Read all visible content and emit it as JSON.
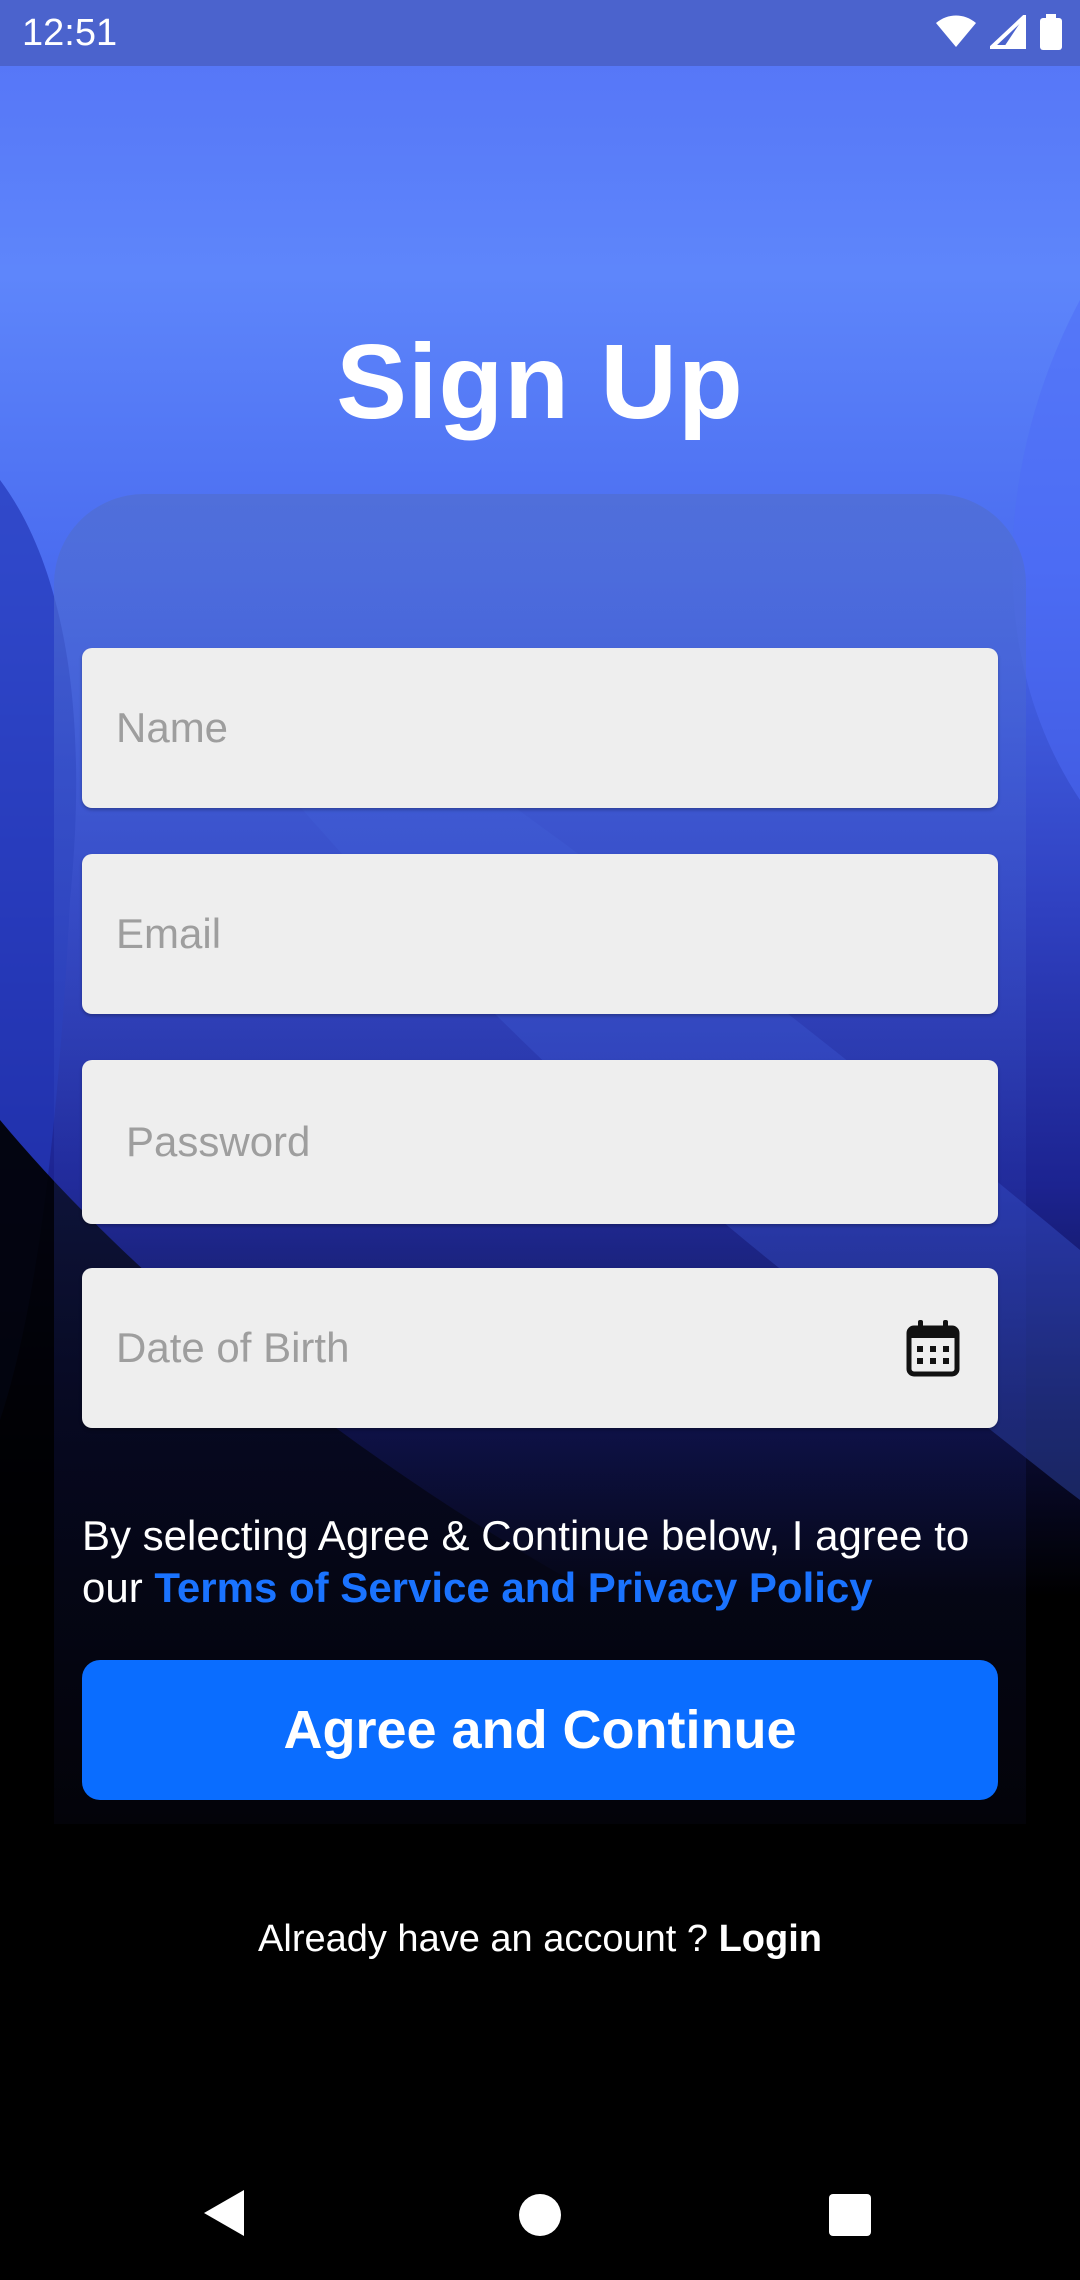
{
  "status_bar": {
    "time": "12:51",
    "icons": [
      "wifi-icon",
      "cell-signal-icon",
      "battery-icon"
    ]
  },
  "screen": {
    "title": "Sign Up"
  },
  "form": {
    "name_placeholder": "Name",
    "email_placeholder": "Email",
    "password_placeholder": "Password",
    "dob_placeholder": "Date of Birth",
    "dob_icon": "calendar-icon"
  },
  "terms": {
    "text": "By selecting Agree & Continue below, I agree to our ",
    "link": "Terms of Service and Privacy Policy"
  },
  "actions": {
    "agree_label": "Agree and Continue"
  },
  "footer": {
    "prompt": "Already have an account ? ",
    "login_label": "Login"
  },
  "nav_bar": {
    "icons": [
      "back-icon",
      "home-icon",
      "recents-icon"
    ]
  },
  "colors": {
    "primary_button": "#0a6dff",
    "link": "#1a73ff",
    "field_bg": "#eeeeee"
  }
}
